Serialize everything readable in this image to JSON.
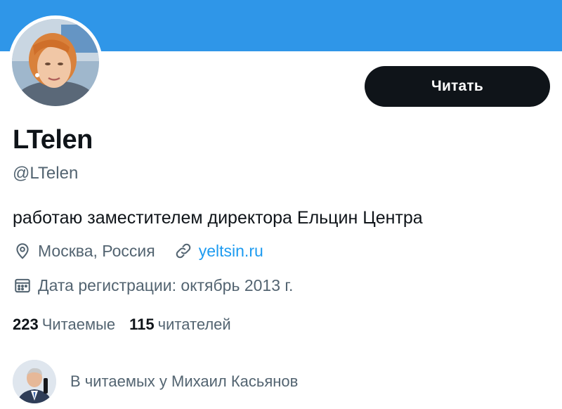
{
  "profile": {
    "display_name": "LTelen",
    "handle": "@LTelen",
    "bio": "работаю заместителем директора Ельцин Центра",
    "location": "Москва, Россия",
    "website": "yeltsin.ru",
    "joined": "Дата регистрации: октябрь 2013 г."
  },
  "actions": {
    "follow_label": "Читать"
  },
  "stats": {
    "following_count": "223",
    "following_label": "Читаемые",
    "followers_count": "115",
    "followers_label": "читателей"
  },
  "followed_by": {
    "text": "В читаемых у Михаил Касьянов"
  },
  "icons": {
    "location": "location-pin-icon",
    "website": "link-icon",
    "joined": "calendar-icon"
  },
  "colors": {
    "banner": "#2f96e8",
    "button_bg": "#0f1419",
    "link": "#1d9bf0",
    "secondary_text": "#536471"
  }
}
